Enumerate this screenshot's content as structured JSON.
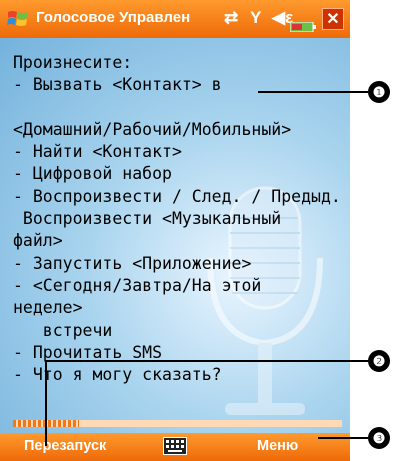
{
  "title_bar": {
    "title": "Голосовое Управлен",
    "icons": [
      "windows-start-icon",
      "connectivity-icon",
      "signal-icon",
      "volume-icon",
      "battery-icon"
    ],
    "close_label": "✕"
  },
  "content": {
    "lines": [
      "Произнесите:",
      "- Вызвать <Контакт> в",
      "",
      "<Домашний/Рабочий/Мобильный>",
      "- Найти <Контакт>",
      "- Цифровой набор",
      "- Воспроизвести / След. / Предыд.",
      " Воспроизвести <Музыкальный",
      "файл>",
      "- Запустить <Приложение>",
      "- <Сегодня/Завтра/На этой",
      "неделе>",
      "   встречи",
      "- Прочитать SMS",
      "- Что я могу сказать?"
    ],
    "progress_fraction": 0.2
  },
  "menu_bar": {
    "left_softkey": "Перезапуск",
    "right_softkey": "Меню",
    "keyboard_icon": "keyboard-icon"
  },
  "callouts": [
    "❶",
    "❷",
    "❸"
  ],
  "colors": {
    "accent": "#ee6a08",
    "background": "#a9d4ee"
  }
}
